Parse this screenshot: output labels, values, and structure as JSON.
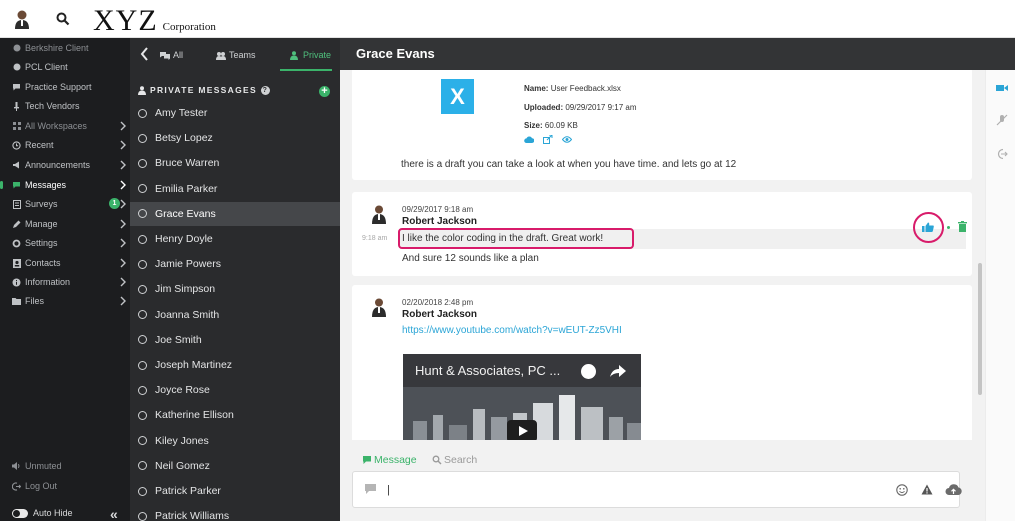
{
  "brand": {
    "name": "XYZ",
    "suffix": "Corporation"
  },
  "nav": {
    "items": [
      {
        "label": "Berkshire Client",
        "icon": "globe-icon",
        "dim": true
      },
      {
        "label": "PCL Client",
        "icon": "globe-icon",
        "dim": false
      },
      {
        "label": "Practice Support",
        "icon": "chat-icon",
        "dim": false
      },
      {
        "label": "Tech Vendors",
        "icon": "pin-icon",
        "dim": false
      },
      {
        "label": "All Workspaces",
        "icon": "grid-icon",
        "dim": true
      },
      {
        "label": "Recent",
        "icon": "clock-icon",
        "dim": false
      },
      {
        "label": "Announcements",
        "icon": "megaphone-icon",
        "dim": false
      },
      {
        "label": "Messages",
        "icon": "message-icon",
        "dim": false,
        "active": true
      },
      {
        "label": "Surveys",
        "icon": "survey-icon",
        "dim": false,
        "badge": "1"
      },
      {
        "label": "Manage",
        "icon": "pencil-icon",
        "dim": false
      },
      {
        "label": "Settings",
        "icon": "gear-icon",
        "dim": false
      },
      {
        "label": "Contacts",
        "icon": "contact-card-icon",
        "dim": false
      },
      {
        "label": "Information",
        "icon": "info-icon",
        "dim": false
      },
      {
        "label": "Files",
        "icon": "folder-icon",
        "dim": false
      }
    ],
    "unmuted": "Unmuted",
    "logout": "Log Out",
    "autohide": "Auto Hide"
  },
  "list": {
    "tabs": {
      "all": "All",
      "teams": "Teams",
      "private": "Private"
    },
    "header": "PRIVATE MESSAGES",
    "contacts": [
      "Amy Tester",
      "Betsy Lopez",
      "Bruce Warren",
      "Emilia Parker",
      "Grace Evans",
      "Henry Doyle",
      "Jamie Powers",
      "Jim Simpson",
      "Joanna Smith",
      "Joe Smith",
      "Joseph Martinez",
      "Joyce Rose",
      "Katherine Ellison",
      "Kiley Jones",
      "Neil Gomez",
      "Patrick Parker",
      "Patrick Williams"
    ],
    "selected": "Grace Evans"
  },
  "chat": {
    "title": "Grace Evans",
    "file": {
      "icon_letter": "X",
      "name_label": "Name:",
      "name": "User Feedback.xlsx",
      "uploaded_label": "Uploaded:",
      "uploaded": "09/29/2017 9:17 am",
      "size_label": "Size:",
      "size": "60.09 KB",
      "text": "there is a draft you can take a look at when you have time. and lets go at 12"
    },
    "message1": {
      "timestamp": "09/29/2017 9:18 am",
      "author": "Robert Jackson",
      "side_time": "9:18 am",
      "line1": "I like the color coding in the draft. Great work!",
      "line2": "And sure 12 sounds like a plan"
    },
    "message2": {
      "timestamp": "02/20/2018 2:48 pm",
      "author": "Robert Jackson",
      "link": "https://www.youtube.com/watch?v=wEUT-Zz5VHI",
      "video_title": "Hunt & Associates, PC ..."
    }
  },
  "compose": {
    "tab_message": "Message",
    "tab_search": "Search",
    "value": "|"
  },
  "colors": {
    "accent": "#3bb36a",
    "highlight": "#d81b6a",
    "link": "#2ba5d6",
    "excel": "#2bb0e8"
  }
}
